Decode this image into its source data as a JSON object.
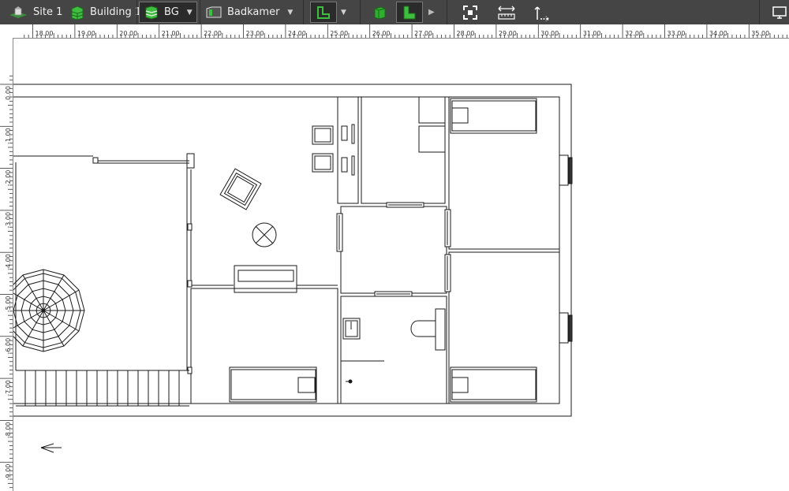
{
  "toolbar": {
    "site_label": "Site 1",
    "building_label": "Building 1",
    "floor_label": "BG",
    "room_label": "Badkamer",
    "accent_color": "#3fbf3f",
    "icons": [
      "site-icon",
      "building-icon",
      "floor-icon",
      "room-icon",
      "floor-plan-view-icon",
      "3d-box-icon",
      "l-shape-icon",
      "fit-view-icon",
      "measure-icon",
      "move-icon",
      "display-icon"
    ]
  },
  "ruler": {
    "horizontal_labels": [
      "18.00",
      "19.00",
      "20.00",
      "21.00",
      "22.00",
      "23.00",
      "24.00",
      "25.00",
      "26.00",
      "27.00",
      "28.00",
      "29.00",
      "30.00",
      "31.00",
      "32.00",
      "33.00",
      "34.00",
      "35.00"
    ],
    "vertical_labels": [
      "0.00",
      "-1.00",
      "-2.00",
      "-3.00",
      "-4.00",
      "-5.00",
      "-6.00",
      "-7.00",
      "-8.00",
      "-9.00"
    ]
  }
}
